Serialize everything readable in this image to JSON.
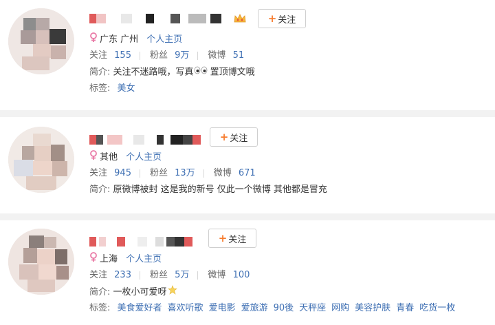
{
  "users": [
    {
      "location": "广东 广州",
      "homepage": "个人主页",
      "follow_label": "关注",
      "stats": [
        {
          "label": "关注",
          "value": "155"
        },
        {
          "label": "粉丝",
          "value": "9万"
        },
        {
          "label": "微博",
          "value": "51"
        }
      ],
      "bio_label": "简介:",
      "bio": "关注不迷路哦，写真",
      "bio_after_emoji": " 置顶博文哦",
      "tags_label": "标签:",
      "tags": [
        "美女"
      ]
    },
    {
      "location": "其他",
      "homepage": "个人主页",
      "follow_label": "关注",
      "stats": [
        {
          "label": "关注",
          "value": "945"
        },
        {
          "label": "粉丝",
          "value": "13万"
        },
        {
          "label": "微博",
          "value": "671"
        }
      ],
      "bio_label": "简介:",
      "bio": "原微博被封 这是我的新号 仅此一个微博 其他都是冒充"
    },
    {
      "location": "上海",
      "homepage": "个人主页",
      "follow_label": "关注",
      "stats": [
        {
          "label": "关注",
          "value": "233"
        },
        {
          "label": "粉丝",
          "value": "5万"
        },
        {
          "label": "微博",
          "value": "100"
        }
      ],
      "bio_label": "简介:",
      "bio": "一枚小可爱呀",
      "tags_label": "标签:",
      "tags": [
        "美食爱好者",
        "喜欢听歌",
        "爱电影",
        "爱旅游",
        "90後",
        "天秤座",
        "网购",
        "美容护肤",
        "青春",
        "吃货一枚"
      ]
    }
  ],
  "colors": {
    "link": "#3e6fb3",
    "plus": "#f77c2e",
    "female": "#e97aa6"
  }
}
